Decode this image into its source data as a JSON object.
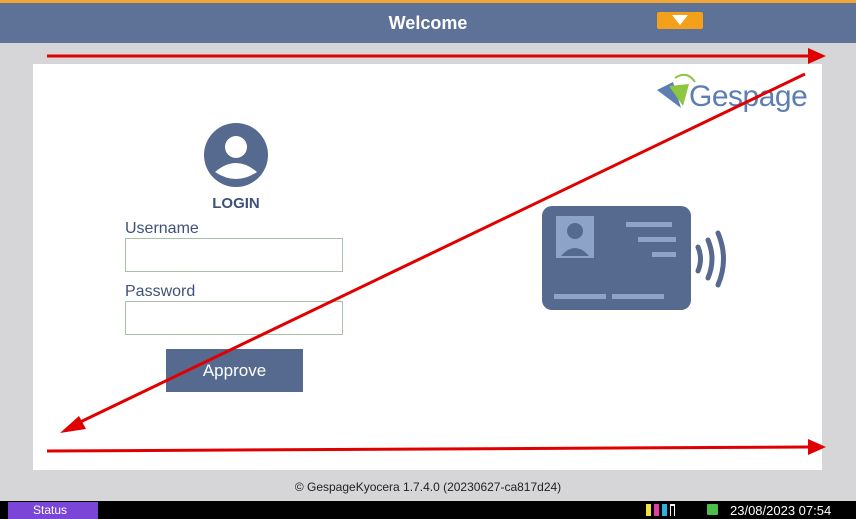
{
  "header": {
    "title": "Welcome",
    "menu_icon": "chevron-down-icon"
  },
  "logo": {
    "text": "Gespage"
  },
  "login": {
    "heading": "LOGIN",
    "username_label": "Username",
    "username_value": "",
    "password_label": "Password",
    "password_value": "",
    "approve_label": "Approve"
  },
  "footer": {
    "copyright": "© GespageKyocera 1.7.4.0 (20230627-ca817d24)"
  },
  "statusbar": {
    "status_label": "Status",
    "datetime": "23/08/2023  07:54"
  },
  "colors": {
    "header": "#5d7296",
    "accent": "#f3a01a",
    "button": "#56698f",
    "status": "#7b45d8",
    "annotation": "#e00000"
  }
}
